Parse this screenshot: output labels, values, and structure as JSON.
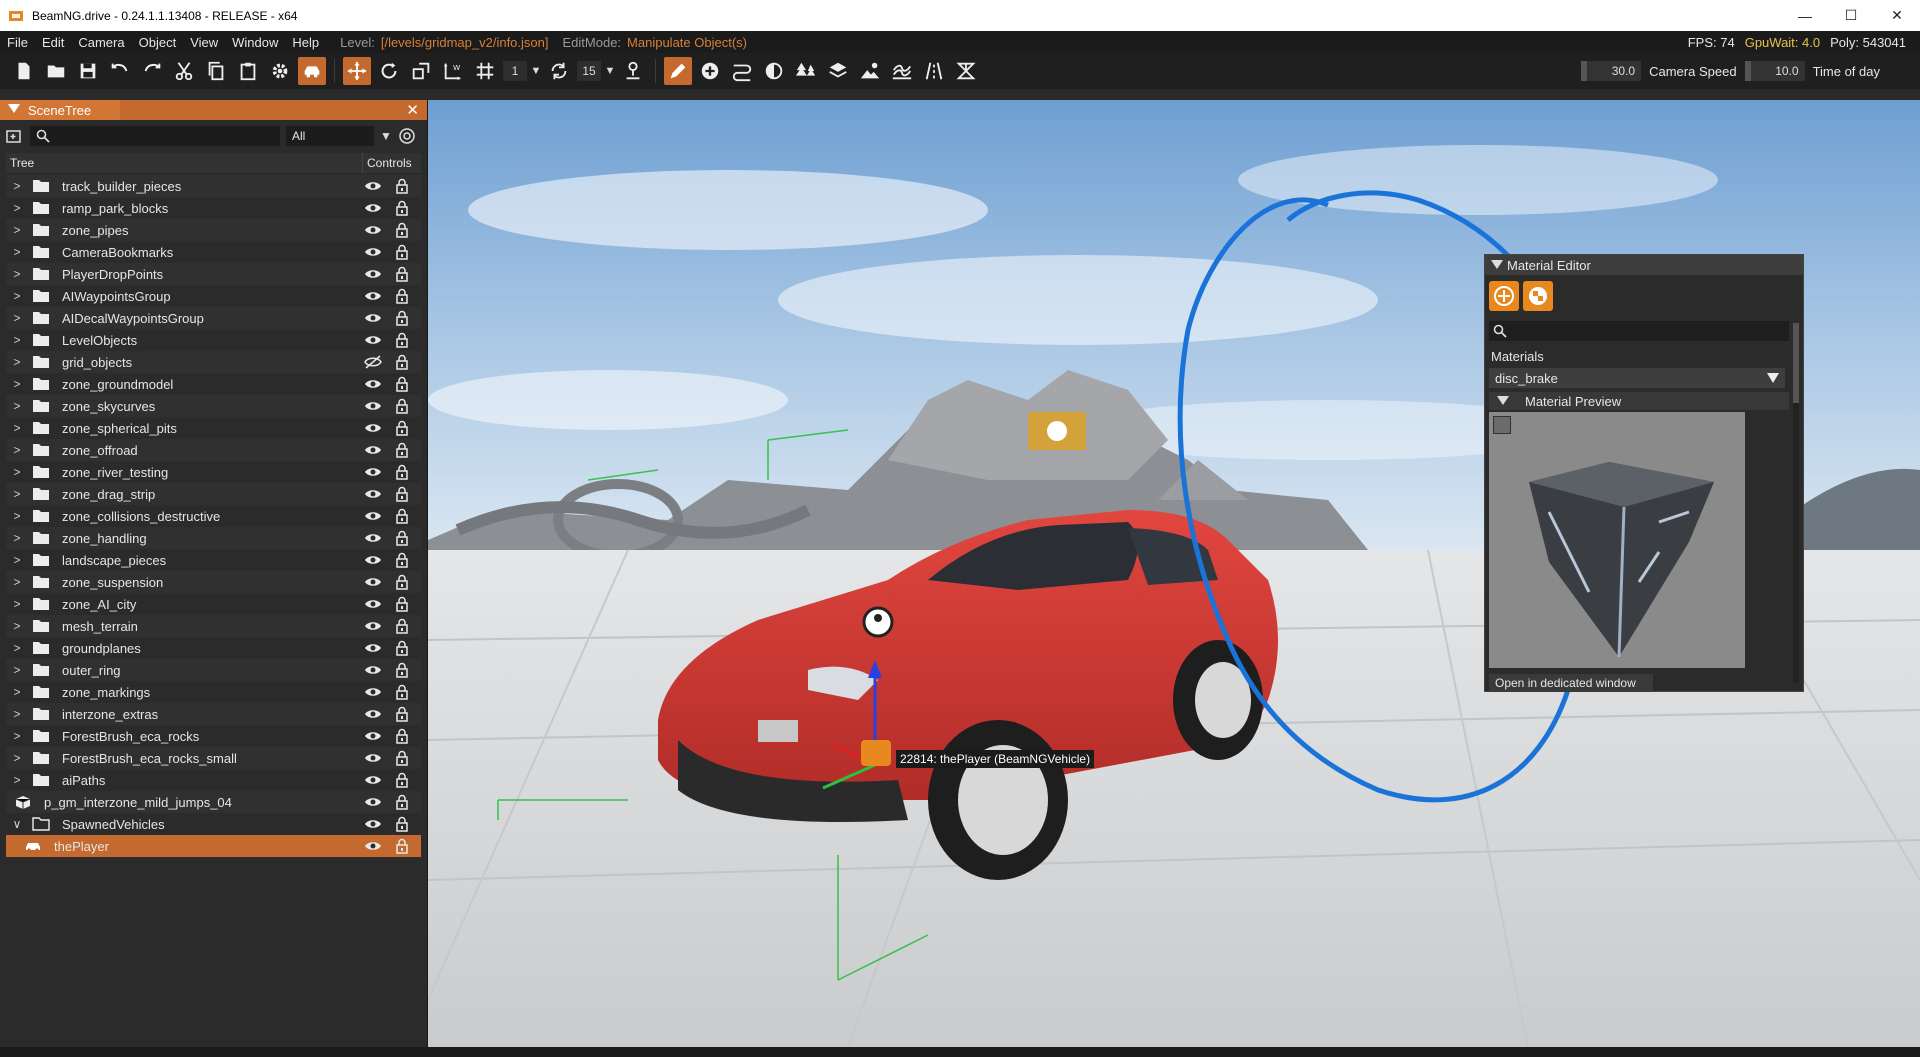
{
  "window": {
    "title": "BeamNG.drive - 0.24.1.1.13408 - RELEASE - x64",
    "minimize": "—",
    "maximize": "☐",
    "close": "✕"
  },
  "menubar": {
    "items": [
      "File",
      "Edit",
      "Camera",
      "Object",
      "View",
      "Window",
      "Help"
    ],
    "level_label": "Level:",
    "level_value": "[/levels/gridmap_v2/info.json]",
    "editmode_label": "EditMode:",
    "editmode_value": "Manipulate Object(s)",
    "fps": "FPS: 74",
    "gpuwait": "GpuWait: 4.0",
    "poly": "Poly: 543041"
  },
  "toolbar": {
    "step_value": "1",
    "angle_value": "15",
    "camera_speed_value": "30.0",
    "camera_speed_label": "Camera Speed",
    "time_value": "10.0",
    "time_label": "Time of day"
  },
  "scene_tree": {
    "title": "SceneTree",
    "filter": "All",
    "col_tree": "Tree",
    "col_controls": "Controls",
    "items": [
      {
        "label": "track_builder_pieces",
        "type": "folder",
        "hidden": false
      },
      {
        "label": "ramp_park_blocks",
        "type": "folder",
        "hidden": false
      },
      {
        "label": "zone_pipes",
        "type": "folder",
        "hidden": false
      },
      {
        "label": "CameraBookmarks",
        "type": "folder",
        "hidden": false
      },
      {
        "label": "PlayerDropPoints",
        "type": "folder",
        "hidden": false
      },
      {
        "label": "AIWaypointsGroup",
        "type": "folder",
        "hidden": false
      },
      {
        "label": "AIDecalWaypointsGroup",
        "type": "folder",
        "hidden": false
      },
      {
        "label": "LevelObjects",
        "type": "folder",
        "hidden": false
      },
      {
        "label": "grid_objects",
        "type": "folder",
        "hidden": true
      },
      {
        "label": "zone_groundmodel",
        "type": "folder",
        "hidden": false
      },
      {
        "label": "zone_skycurves",
        "type": "folder",
        "hidden": false
      },
      {
        "label": "zone_spherical_pits",
        "type": "folder",
        "hidden": false
      },
      {
        "label": "zone_offroad",
        "type": "folder",
        "hidden": false
      },
      {
        "label": "zone_river_testing",
        "type": "folder",
        "hidden": false
      },
      {
        "label": "zone_drag_strip",
        "type": "folder",
        "hidden": false
      },
      {
        "label": "zone_collisions_destructive",
        "type": "folder",
        "hidden": false
      },
      {
        "label": "zone_handling",
        "type": "folder",
        "hidden": false
      },
      {
        "label": "landscape_pieces",
        "type": "folder",
        "hidden": false
      },
      {
        "label": "zone_suspension",
        "type": "folder",
        "hidden": false
      },
      {
        "label": "zone_AI_city",
        "type": "folder",
        "hidden": false
      },
      {
        "label": "mesh_terrain",
        "type": "folder",
        "hidden": false
      },
      {
        "label": "groundplanes",
        "type": "folder",
        "hidden": false
      },
      {
        "label": "outer_ring",
        "type": "folder",
        "hidden": false
      },
      {
        "label": "zone_markings",
        "type": "folder",
        "hidden": false
      },
      {
        "label": "interzone_extras",
        "type": "folder",
        "hidden": false
      },
      {
        "label": "ForestBrush_eca_rocks",
        "type": "folder",
        "hidden": false
      },
      {
        "label": "ForestBrush_eca_rocks_small",
        "type": "folder",
        "hidden": false
      },
      {
        "label": "aiPaths",
        "type": "folder",
        "hidden": false
      },
      {
        "label": "p_gm_interzone_mild_jumps_04",
        "type": "object",
        "hidden": false
      },
      {
        "label": "SpawnedVehicles",
        "type": "folder-open",
        "hidden": false
      },
      {
        "label": "thePlayer",
        "type": "vehicle",
        "hidden": false,
        "selected": true
      }
    ]
  },
  "material_editor": {
    "title": "Material Editor",
    "materials_label": "Materials",
    "selected_material": "disc_brake",
    "preview_label": "Material Preview",
    "open_button": "Open in dedicated window"
  },
  "viewport": {
    "vehicle_label": "22814: thePlayer (BeamNGVehicle)"
  },
  "colors": {
    "accent": "#c46a2e",
    "annotation": "#1a73d9",
    "car": "#d63a35"
  }
}
